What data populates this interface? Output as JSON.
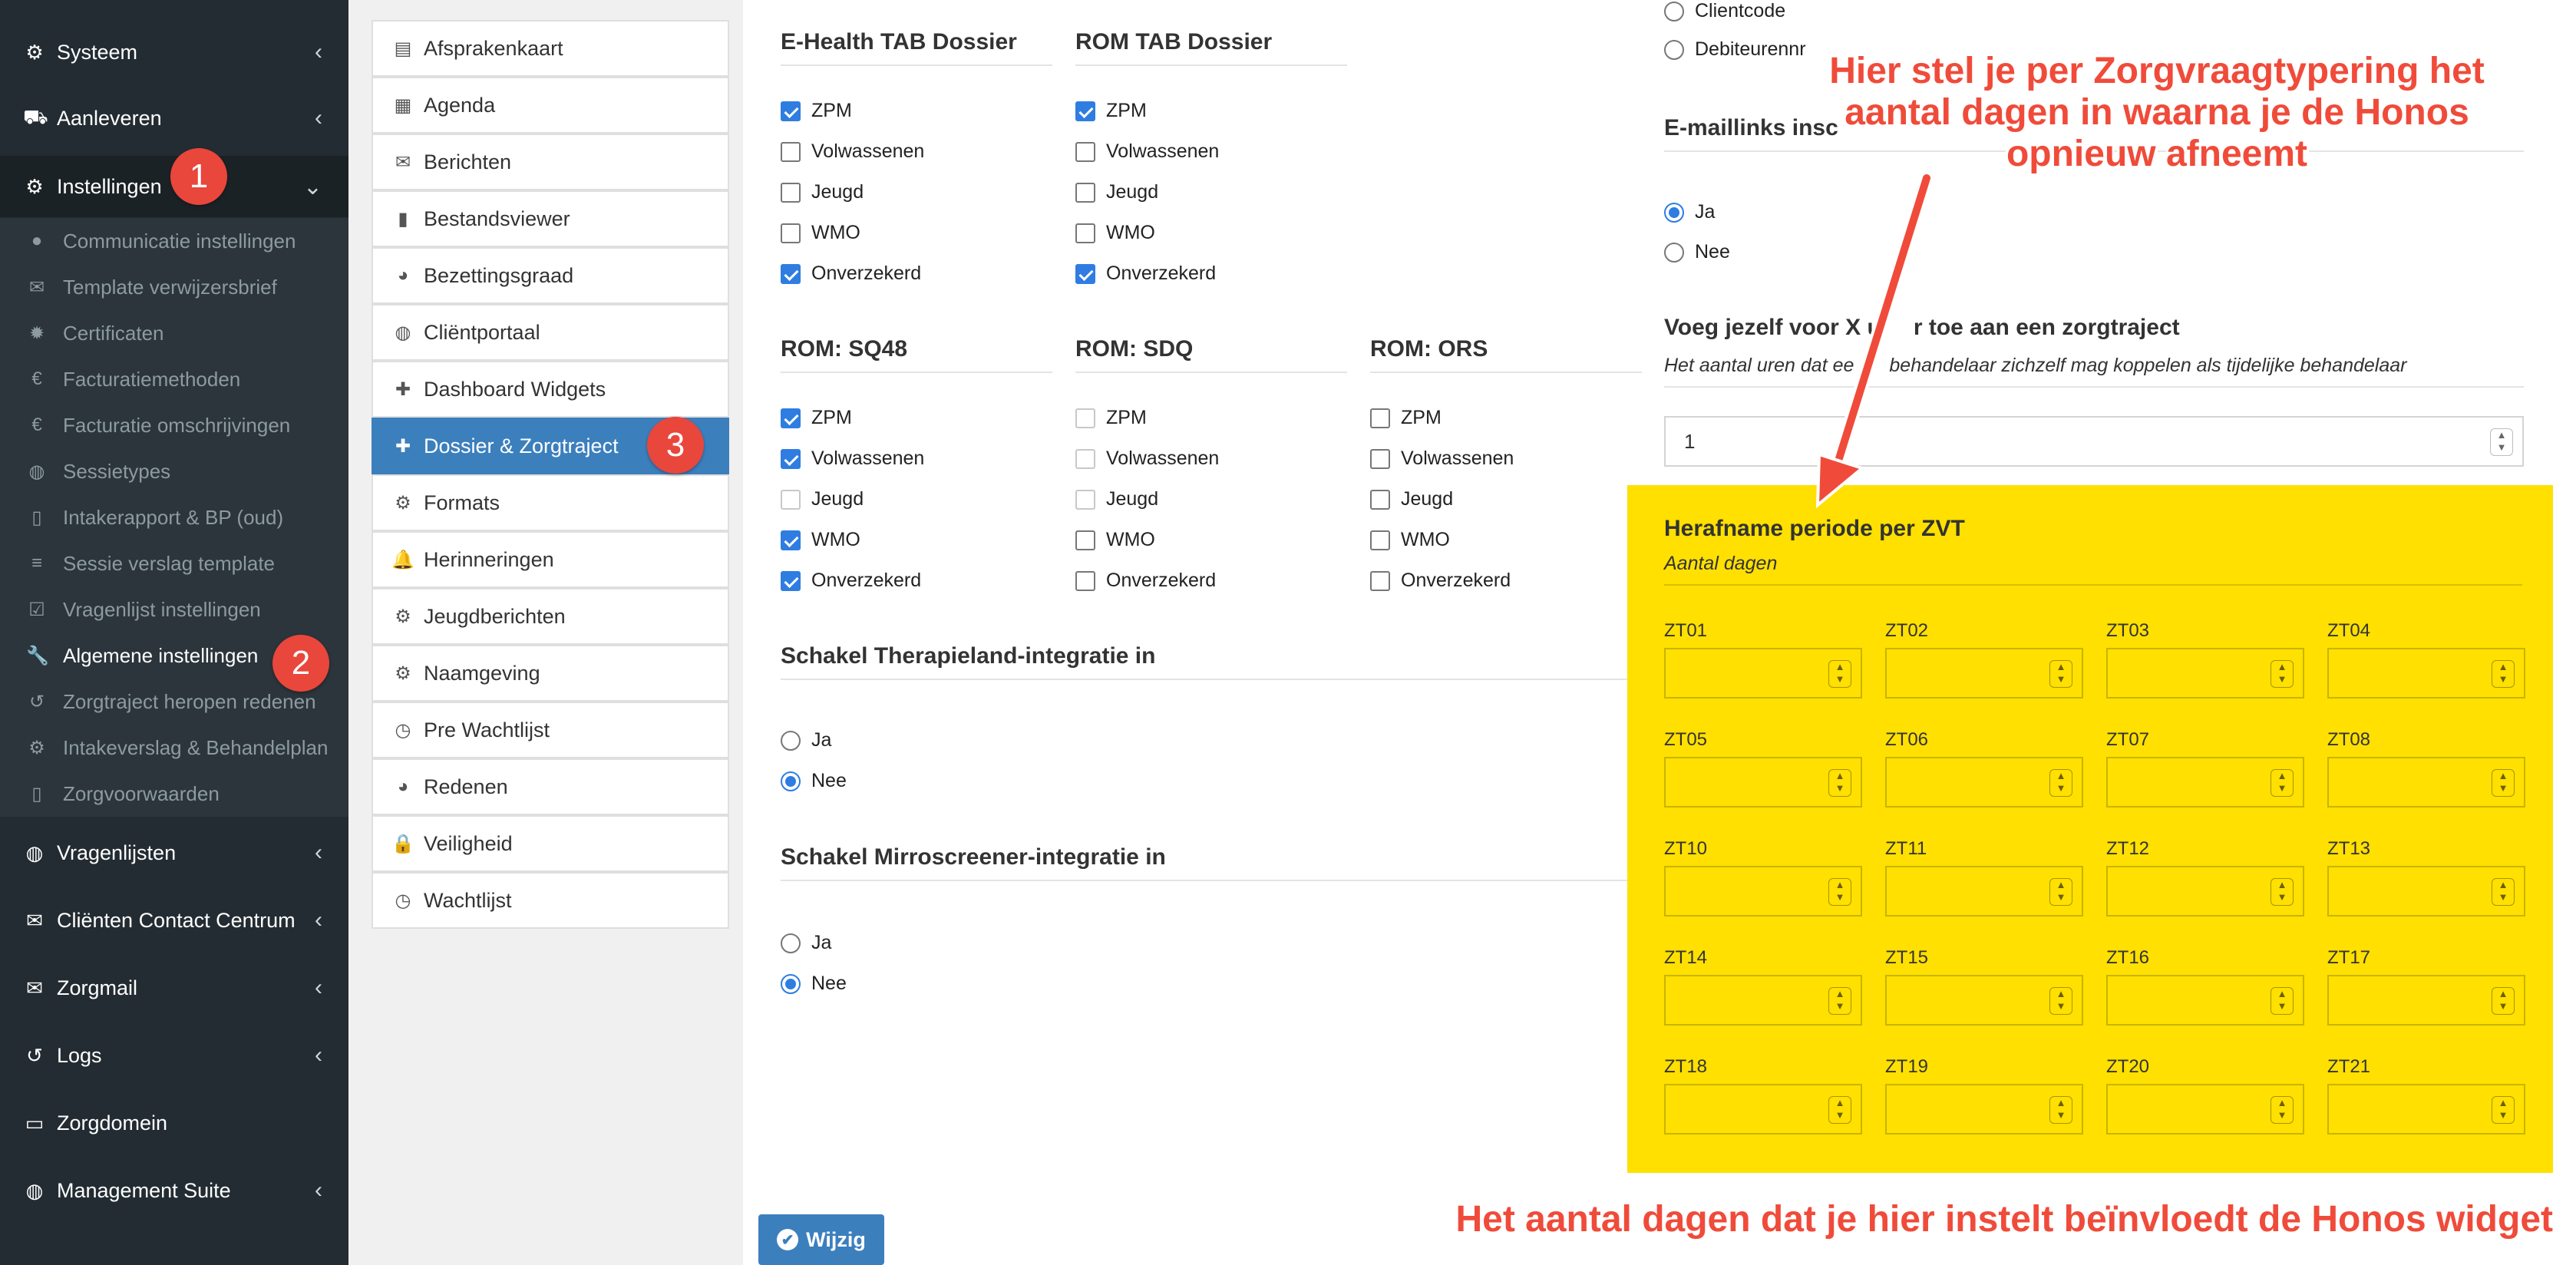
{
  "sidebar": {
    "items_top": [
      {
        "label": "Systeem",
        "icon": "gears-icon"
      },
      {
        "label": "Aanleveren",
        "icon": "truck-icon"
      },
      {
        "label": "Instellingen",
        "icon": "gear-icon"
      }
    ],
    "sub_items": [
      {
        "label": "Communicatie instellingen",
        "icon": "comments-icon"
      },
      {
        "label": "Template verwijzersbrief",
        "icon": "envelope-icon"
      },
      {
        "label": "Certificaten",
        "icon": "certificate-icon"
      },
      {
        "label": "Facturatiemethoden",
        "icon": "euro-icon"
      },
      {
        "label": "Facturatie omschrijvingen",
        "icon": "euro-icon"
      },
      {
        "label": "Sessietypes",
        "icon": "globe-icon"
      },
      {
        "label": "Intakerapport & BP (oud)",
        "icon": "file-icon"
      },
      {
        "label": "Sessie verslag template",
        "icon": "list-icon"
      },
      {
        "label": "Vragenlijst instellingen",
        "icon": "check-square-icon"
      },
      {
        "label": "Algemene instellingen",
        "icon": "wrench-icon"
      },
      {
        "label": "Zorgtraject heropen redenen",
        "icon": "undo-icon"
      },
      {
        "label": "Intakeverslag & Behandelplan",
        "icon": "gear-icon"
      },
      {
        "label": "Zorgvoorwaarden",
        "icon": "pdf-icon"
      }
    ],
    "items_bottom": [
      {
        "label": "Vragenlijsten",
        "icon": "globe-icon"
      },
      {
        "label": "Cliënten Contact Centrum",
        "icon": "envelope-icon"
      },
      {
        "label": "Zorgmail",
        "icon": "envelope-icon"
      },
      {
        "label": "Logs",
        "icon": "history-icon"
      },
      {
        "label": "Zorgdomein",
        "icon": "inbox-icon"
      },
      {
        "label": "Management Suite",
        "icon": "globe-icon"
      }
    ]
  },
  "menu2": [
    {
      "label": "Afsprakenkaart",
      "icon": "list-alt-icon"
    },
    {
      "label": "Agenda",
      "icon": "calendar-icon"
    },
    {
      "label": "Berichten",
      "icon": "envelope-icon"
    },
    {
      "label": "Bestandsviewer",
      "icon": "file-icon"
    },
    {
      "label": "Bezettingsgraad",
      "icon": "pie-chart-icon"
    },
    {
      "label": "Cliëntportaal",
      "icon": "globe-icon"
    },
    {
      "label": "Dashboard Widgets",
      "icon": "puzzle-icon"
    },
    {
      "label": "Dossier & Zorgtraject",
      "icon": "medkit-icon"
    },
    {
      "label": "Formats",
      "icon": "gear-icon"
    },
    {
      "label": "Herinneringen",
      "icon": "bell-icon"
    },
    {
      "label": "Jeugdberichten",
      "icon": "gear-icon"
    },
    {
      "label": "Naamgeving",
      "icon": "gear-icon"
    },
    {
      "label": "Pre Wachtlijst",
      "icon": "clock-icon"
    },
    {
      "label": "Redenen",
      "icon": "pie-chart-icon"
    },
    {
      "label": "Veiligheid",
      "icon": "lock-icon"
    },
    {
      "label": "Wachtlijst",
      "icon": "clock-icon"
    }
  ],
  "checkbox_groups": [
    {
      "title": "E-Health TAB Dossier",
      "options": [
        {
          "label": "ZPM",
          "checked": true
        },
        {
          "label": "Volwassenen",
          "checked": false
        },
        {
          "label": "Jeugd",
          "checked": false
        },
        {
          "label": "WMO",
          "checked": false
        },
        {
          "label": "Onverzekerd",
          "checked": true
        }
      ]
    },
    {
      "title": "ROM TAB Dossier",
      "options": [
        {
          "label": "ZPM",
          "checked": true
        },
        {
          "label": "Volwassenen",
          "checked": false
        },
        {
          "label": "Jeugd",
          "checked": false
        },
        {
          "label": "WMO",
          "checked": false
        },
        {
          "label": "Onverzekerd",
          "checked": true
        }
      ]
    },
    {
      "title": "ROM: SQ48",
      "options": [
        {
          "label": "ZPM",
          "checked": true
        },
        {
          "label": "Volwassenen",
          "checked": true
        },
        {
          "label": "Jeugd",
          "checked": false
        },
        {
          "label": "WMO",
          "checked": true
        },
        {
          "label": "Onverzekerd",
          "checked": true
        }
      ]
    },
    {
      "title": "ROM: SDQ",
      "options": [
        {
          "label": "ZPM",
          "checked": false
        },
        {
          "label": "Volwassenen",
          "checked": false
        },
        {
          "label": "Jeugd",
          "checked": false
        },
        {
          "label": "WMO",
          "checked": false
        },
        {
          "label": "Onverzekerd",
          "checked": false
        }
      ]
    },
    {
      "title": "ROM: ORS",
      "options": [
        {
          "label": "ZPM",
          "checked": false
        },
        {
          "label": "Volwassenen",
          "checked": false
        },
        {
          "label": "Jeugd",
          "checked": false
        },
        {
          "label": "WMO",
          "checked": false
        },
        {
          "label": "Onverzekerd",
          "checked": false
        }
      ]
    }
  ],
  "therapieland": {
    "title": "Schakel Therapieland-integratie in",
    "options": [
      {
        "label": "Ja",
        "selected": false
      },
      {
        "label": "Nee",
        "selected": true
      }
    ]
  },
  "mirroscreener": {
    "title": "Schakel Mirroscreener-integratie in",
    "options": [
      {
        "label": "Ja",
        "selected": false
      },
      {
        "label": "Nee",
        "selected": true
      }
    ]
  },
  "identifier_options": [
    "Clientcode",
    "Debiteurennr"
  ],
  "email_links": {
    "title": "E-maillinks insc",
    "options": [
      {
        "label": "Ja",
        "selected": true
      },
      {
        "label": "Nee",
        "selected": false
      }
    ]
  },
  "self_link": {
    "title": "Voeg jezelf voor X u",
    "title_end": "r toe aan een zorgtraject",
    "subtitle": "Het aantal uren dat ee",
    "subtitle_end": "behandelaar zichzelf mag koppelen als tijdelijke behandelaar",
    "value": "1"
  },
  "zvt_panel": {
    "title": "Herafname periode per ZVT",
    "subtitle": "Aantal dagen",
    "codes": [
      "ZT01",
      "ZT02",
      "ZT03",
      "ZT04",
      "ZT05",
      "ZT06",
      "ZT07",
      "ZT08",
      "ZT10",
      "ZT11",
      "ZT12",
      "ZT13",
      "ZT14",
      "ZT15",
      "ZT16",
      "ZT17",
      "ZT18",
      "ZT19",
      "ZT20",
      "ZT21"
    ]
  },
  "save_label": "Wijzig",
  "annotations": {
    "top": "Hier stel je per Zorgvraagtypering het aantal dagen in waarna je de Honos opnieuw afneemt",
    "bottom": "Het aantal dagen dat je hier instelt beïnvloedt de Honos widget",
    "badges": [
      "1",
      "2",
      "3"
    ]
  },
  "colors": {
    "accent": "#3c7fbd",
    "highlight": "#ffe000",
    "annotation": "#f04b3a",
    "sidebar": "#232c32"
  }
}
